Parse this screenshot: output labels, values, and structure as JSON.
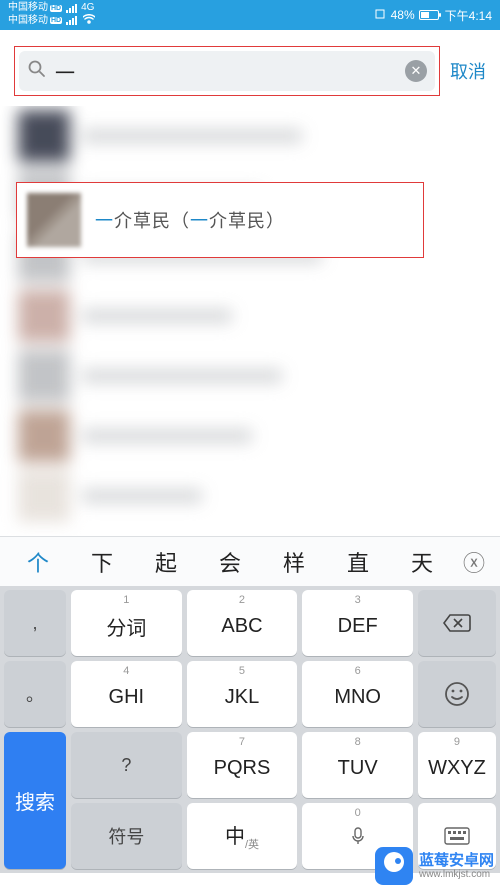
{
  "status": {
    "carrier": "中国移动",
    "network": "4G",
    "battery_pct": "48%",
    "time": "下午4:14"
  },
  "search": {
    "value": "一",
    "cancel": "取消"
  },
  "result": {
    "prefix_hl": "一",
    "name_rest": "介草民",
    "paren_open": "（",
    "paren_hl": "一",
    "paren_rest": "介草民）"
  },
  "candidates": [
    "个",
    "下",
    "起",
    "会",
    "样",
    "直",
    "天"
  ],
  "keyboard": {
    "side_punct": [
      ",",
      "。",
      "?"
    ],
    "keys": [
      {
        "num": "1",
        "label": "分词"
      },
      {
        "num": "2",
        "label": "ABC"
      },
      {
        "num": "3",
        "label": "DEF"
      },
      {
        "num": "4",
        "label": "GHI"
      },
      {
        "num": "5",
        "label": "JKL"
      },
      {
        "num": "6",
        "label": "MNO"
      },
      {
        "num": "7",
        "label": "PQRS"
      },
      {
        "num": "8",
        "label": "TUV"
      },
      {
        "num": "9",
        "label": "WXYZ"
      }
    ],
    "zero": "0",
    "symbol": "符号",
    "lang_main": "中",
    "lang_sub": "/英",
    "search": "搜索"
  },
  "watermark": {
    "title": "蓝莓安卓网",
    "url": "www.lmkjst.com"
  }
}
